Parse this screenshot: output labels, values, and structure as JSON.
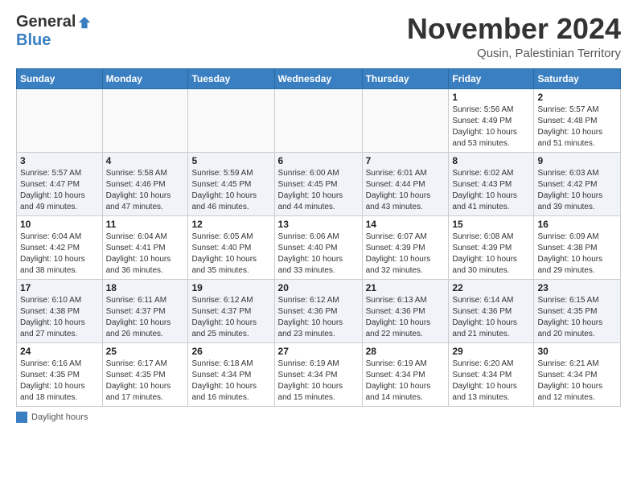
{
  "header": {
    "logo_general": "General",
    "logo_blue": "Blue",
    "month_title": "November 2024",
    "subtitle": "Qusin, Palestinian Territory"
  },
  "weekdays": [
    "Sunday",
    "Monday",
    "Tuesday",
    "Wednesday",
    "Thursday",
    "Friday",
    "Saturday"
  ],
  "weeks": [
    [
      {
        "day": "",
        "info": ""
      },
      {
        "day": "",
        "info": ""
      },
      {
        "day": "",
        "info": ""
      },
      {
        "day": "",
        "info": ""
      },
      {
        "day": "",
        "info": ""
      },
      {
        "day": "1",
        "info": "Sunrise: 5:56 AM\nSunset: 4:49 PM\nDaylight: 10 hours\nand 53 minutes."
      },
      {
        "day": "2",
        "info": "Sunrise: 5:57 AM\nSunset: 4:48 PM\nDaylight: 10 hours\nand 51 minutes."
      }
    ],
    [
      {
        "day": "3",
        "info": "Sunrise: 5:57 AM\nSunset: 4:47 PM\nDaylight: 10 hours\nand 49 minutes."
      },
      {
        "day": "4",
        "info": "Sunrise: 5:58 AM\nSunset: 4:46 PM\nDaylight: 10 hours\nand 47 minutes."
      },
      {
        "day": "5",
        "info": "Sunrise: 5:59 AM\nSunset: 4:45 PM\nDaylight: 10 hours\nand 46 minutes."
      },
      {
        "day": "6",
        "info": "Sunrise: 6:00 AM\nSunset: 4:45 PM\nDaylight: 10 hours\nand 44 minutes."
      },
      {
        "day": "7",
        "info": "Sunrise: 6:01 AM\nSunset: 4:44 PM\nDaylight: 10 hours\nand 43 minutes."
      },
      {
        "day": "8",
        "info": "Sunrise: 6:02 AM\nSunset: 4:43 PM\nDaylight: 10 hours\nand 41 minutes."
      },
      {
        "day": "9",
        "info": "Sunrise: 6:03 AM\nSunset: 4:42 PM\nDaylight: 10 hours\nand 39 minutes."
      }
    ],
    [
      {
        "day": "10",
        "info": "Sunrise: 6:04 AM\nSunset: 4:42 PM\nDaylight: 10 hours\nand 38 minutes."
      },
      {
        "day": "11",
        "info": "Sunrise: 6:04 AM\nSunset: 4:41 PM\nDaylight: 10 hours\nand 36 minutes."
      },
      {
        "day": "12",
        "info": "Sunrise: 6:05 AM\nSunset: 4:40 PM\nDaylight: 10 hours\nand 35 minutes."
      },
      {
        "day": "13",
        "info": "Sunrise: 6:06 AM\nSunset: 4:40 PM\nDaylight: 10 hours\nand 33 minutes."
      },
      {
        "day": "14",
        "info": "Sunrise: 6:07 AM\nSunset: 4:39 PM\nDaylight: 10 hours\nand 32 minutes."
      },
      {
        "day": "15",
        "info": "Sunrise: 6:08 AM\nSunset: 4:39 PM\nDaylight: 10 hours\nand 30 minutes."
      },
      {
        "day": "16",
        "info": "Sunrise: 6:09 AM\nSunset: 4:38 PM\nDaylight: 10 hours\nand 29 minutes."
      }
    ],
    [
      {
        "day": "17",
        "info": "Sunrise: 6:10 AM\nSunset: 4:38 PM\nDaylight: 10 hours\nand 27 minutes."
      },
      {
        "day": "18",
        "info": "Sunrise: 6:11 AM\nSunset: 4:37 PM\nDaylight: 10 hours\nand 26 minutes."
      },
      {
        "day": "19",
        "info": "Sunrise: 6:12 AM\nSunset: 4:37 PM\nDaylight: 10 hours\nand 25 minutes."
      },
      {
        "day": "20",
        "info": "Sunrise: 6:12 AM\nSunset: 4:36 PM\nDaylight: 10 hours\nand 23 minutes."
      },
      {
        "day": "21",
        "info": "Sunrise: 6:13 AM\nSunset: 4:36 PM\nDaylight: 10 hours\nand 22 minutes."
      },
      {
        "day": "22",
        "info": "Sunrise: 6:14 AM\nSunset: 4:36 PM\nDaylight: 10 hours\nand 21 minutes."
      },
      {
        "day": "23",
        "info": "Sunrise: 6:15 AM\nSunset: 4:35 PM\nDaylight: 10 hours\nand 20 minutes."
      }
    ],
    [
      {
        "day": "24",
        "info": "Sunrise: 6:16 AM\nSunset: 4:35 PM\nDaylight: 10 hours\nand 18 minutes."
      },
      {
        "day": "25",
        "info": "Sunrise: 6:17 AM\nSunset: 4:35 PM\nDaylight: 10 hours\nand 17 minutes."
      },
      {
        "day": "26",
        "info": "Sunrise: 6:18 AM\nSunset: 4:34 PM\nDaylight: 10 hours\nand 16 minutes."
      },
      {
        "day": "27",
        "info": "Sunrise: 6:19 AM\nSunset: 4:34 PM\nDaylight: 10 hours\nand 15 minutes."
      },
      {
        "day": "28",
        "info": "Sunrise: 6:19 AM\nSunset: 4:34 PM\nDaylight: 10 hours\nand 14 minutes."
      },
      {
        "day": "29",
        "info": "Sunrise: 6:20 AM\nSunset: 4:34 PM\nDaylight: 10 hours\nand 13 minutes."
      },
      {
        "day": "30",
        "info": "Sunrise: 6:21 AM\nSunset: 4:34 PM\nDaylight: 10 hours\nand 12 minutes."
      }
    ]
  ],
  "footer": {
    "legend_label": "Daylight hours"
  }
}
